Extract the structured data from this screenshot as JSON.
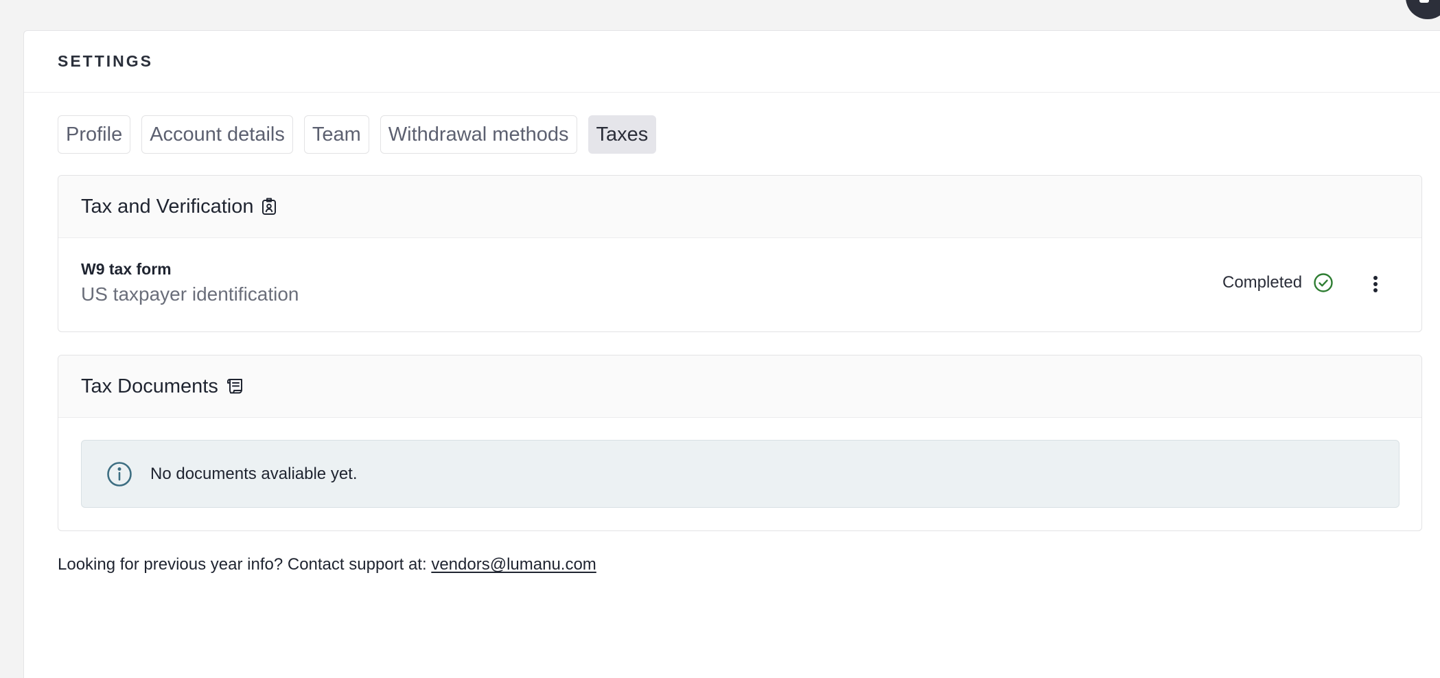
{
  "header": {
    "avatar_icon": "user-avatar-icon"
  },
  "settings": {
    "title": "SETTINGS"
  },
  "tabs": [
    {
      "label": "Profile",
      "active": false
    },
    {
      "label": "Account details",
      "active": false
    },
    {
      "label": "Team",
      "active": false
    },
    {
      "label": "Withdrawal methods",
      "active": false
    },
    {
      "label": "Taxes",
      "active": true
    }
  ],
  "verification": {
    "title": "Tax and Verification",
    "title_icon": "id-badge-icon",
    "w9": {
      "title": "W9 tax form",
      "subtitle": "US taxpayer identification",
      "status": "Completed",
      "status_icon": "check-circle-icon",
      "status_color": "#2e7d32",
      "menu_icon": "more-vertical-icon"
    }
  },
  "documents": {
    "title": "Tax Documents",
    "title_icon": "scroll-icon",
    "empty_message": "No documents avaliable yet.",
    "empty_icon": "info-circle-icon",
    "info_color": "#3d6e82"
  },
  "footer": {
    "prompt": "Looking for previous year info? Contact support at:",
    "email": "vendors@lumanu.com"
  }
}
